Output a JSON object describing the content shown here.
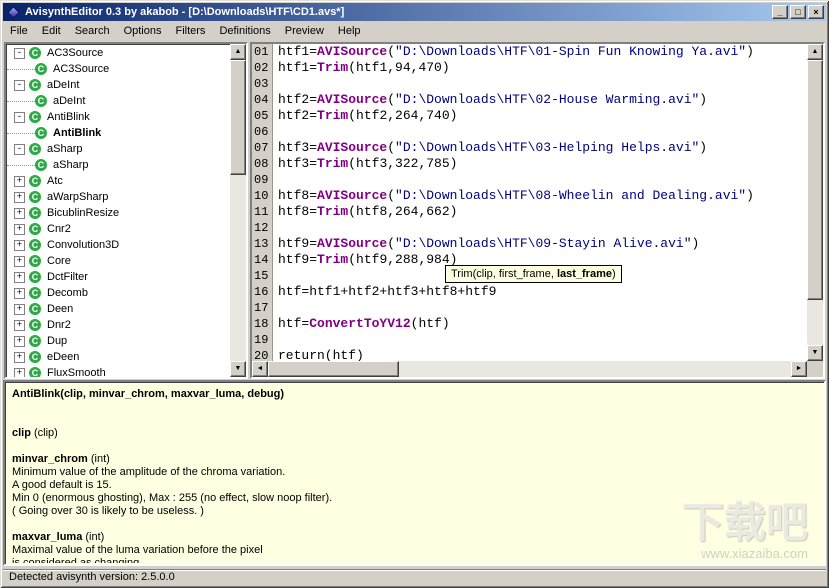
{
  "window": {
    "title": "AvisynthEditor 0.3 by akabob - [D:\\Downloads\\HTF\\CD1.avs*]",
    "buttons": {
      "minimize": "_",
      "maximize": "□",
      "close": "×"
    }
  },
  "menu": {
    "items": [
      "File",
      "Edit",
      "Search",
      "Options",
      "Filters",
      "Definitions",
      "Preview",
      "Help"
    ]
  },
  "icons": {
    "up": "▲",
    "down": "▼",
    "left": "◄",
    "right": "►",
    "expand": "+",
    "collapse": "-"
  },
  "colors": {
    "keyword": "#800080",
    "string": "#000080",
    "titlebar_left": "#0A246A",
    "titlebar_right": "#A6CAF0",
    "help_bg": "#FFFFE1",
    "window_bg": "#D4D0C8"
  },
  "tree": {
    "icon": "C",
    "items": [
      {
        "label": "AC3Source",
        "expanded": true,
        "children": [
          {
            "label": "AC3Source",
            "selected": false
          }
        ]
      },
      {
        "label": "aDeInt",
        "expanded": true,
        "children": [
          {
            "label": "aDeInt",
            "selected": false
          }
        ]
      },
      {
        "label": "AntiBlink",
        "expanded": true,
        "children": [
          {
            "label": "AntiBlink",
            "selected": true
          }
        ]
      },
      {
        "label": "aSharp",
        "expanded": true,
        "children": [
          {
            "label": "aSharp",
            "selected": false
          }
        ]
      },
      {
        "label": "Atc",
        "expanded": false,
        "children": []
      },
      {
        "label": "aWarpSharp",
        "expanded": false,
        "children": []
      },
      {
        "label": "BicublinResize",
        "expanded": false,
        "children": []
      },
      {
        "label": "Cnr2",
        "expanded": false,
        "children": []
      },
      {
        "label": "Convolution3D",
        "expanded": false,
        "children": []
      },
      {
        "label": "Core",
        "expanded": false,
        "children": []
      },
      {
        "label": "DctFilter",
        "expanded": false,
        "children": []
      },
      {
        "label": "Decomb",
        "expanded": false,
        "children": []
      },
      {
        "label": "Deen",
        "expanded": false,
        "children": []
      },
      {
        "label": "Dnr2",
        "expanded": false,
        "children": []
      },
      {
        "label": "Dup",
        "expanded": false,
        "children": []
      },
      {
        "label": "eDeen",
        "expanded": false,
        "children": []
      },
      {
        "label": "FluxSmooth",
        "expanded": false,
        "children": []
      }
    ]
  },
  "editor": {
    "lines": [
      {
        "num": "01",
        "segments": [
          [
            "p",
            "htf1="
          ],
          [
            "k",
            "AVISource"
          ],
          [
            "p",
            "("
          ],
          [
            "s",
            "\"D:\\Downloads\\HTF\\01-Spin Fun Knowing Ya.avi\""
          ],
          [
            "p",
            ")"
          ]
        ]
      },
      {
        "num": "02",
        "segments": [
          [
            "p",
            "htf1="
          ],
          [
            "k",
            "Trim"
          ],
          [
            "p",
            "(htf1,94,470)"
          ]
        ]
      },
      {
        "num": "03",
        "segments": []
      },
      {
        "num": "04",
        "segments": [
          [
            "p",
            "htf2="
          ],
          [
            "k",
            "AVISource"
          ],
          [
            "p",
            "("
          ],
          [
            "s",
            "\"D:\\Downloads\\HTF\\02-House Warming.avi\""
          ],
          [
            "p",
            ")"
          ]
        ]
      },
      {
        "num": "05",
        "segments": [
          [
            "p",
            "htf2="
          ],
          [
            "k",
            "Trim"
          ],
          [
            "p",
            "(htf2,264,740)"
          ]
        ]
      },
      {
        "num": "06",
        "segments": []
      },
      {
        "num": "07",
        "segments": [
          [
            "p",
            "htf3="
          ],
          [
            "k",
            "AVISource"
          ],
          [
            "p",
            "("
          ],
          [
            "s",
            "\"D:\\Downloads\\HTF\\03-Helping Helps.avi\""
          ],
          [
            "p",
            ")"
          ]
        ]
      },
      {
        "num": "08",
        "segments": [
          [
            "p",
            "htf3="
          ],
          [
            "k",
            "Trim"
          ],
          [
            "p",
            "(htf3,322,785)"
          ]
        ]
      },
      {
        "num": "09",
        "segments": []
      },
      {
        "num": "10",
        "segments": [
          [
            "p",
            "htf8="
          ],
          [
            "k",
            "AVISource"
          ],
          [
            "p",
            "("
          ],
          [
            "s",
            "\"D:\\Downloads\\HTF\\08-Wheelin and Dealing.avi\""
          ],
          [
            "p",
            ")"
          ]
        ]
      },
      {
        "num": "11",
        "segments": [
          [
            "p",
            "htf8="
          ],
          [
            "k",
            "Trim"
          ],
          [
            "p",
            "(htf8,264,662)"
          ]
        ]
      },
      {
        "num": "12",
        "segments": []
      },
      {
        "num": "13",
        "segments": [
          [
            "p",
            "htf9="
          ],
          [
            "k",
            "AVISource"
          ],
          [
            "p",
            "("
          ],
          [
            "s",
            "\"D:\\Downloads\\HTF\\09-Stayin Alive.avi\""
          ],
          [
            "p",
            ")"
          ]
        ]
      },
      {
        "num": "14",
        "segments": [
          [
            "p",
            "htf9="
          ],
          [
            "k",
            "Trim"
          ],
          [
            "p",
            "(htf9,288,984)"
          ]
        ]
      },
      {
        "num": "15",
        "segments": []
      },
      {
        "num": "16",
        "segments": [
          [
            "p",
            "htf=htf1+htf2+htf3+htf8+htf9"
          ]
        ]
      },
      {
        "num": "17",
        "segments": []
      },
      {
        "num": "18",
        "segments": [
          [
            "p",
            "htf="
          ],
          [
            "k",
            "ConvertToYV12"
          ],
          [
            "p",
            "(htf)"
          ]
        ]
      },
      {
        "num": "19",
        "segments": []
      },
      {
        "num": "20",
        "segments": [
          [
            "p",
            "return(htf)"
          ]
        ]
      }
    ]
  },
  "tooltip": {
    "segments": [
      [
        "p",
        "Trim(clip, first_frame, "
      ],
      [
        "b",
        "last_frame"
      ],
      [
        "p",
        ")"
      ]
    ]
  },
  "help": {
    "lines": [
      [
        [
          "b",
          "AntiBlink(clip, minvar_chrom, maxvar_luma, debug)"
        ]
      ],
      [],
      [],
      [
        [
          "b",
          "clip"
        ],
        [
          "p",
          " (clip)"
        ]
      ],
      [],
      [
        [
          "b",
          "minvar_chrom"
        ],
        [
          "p",
          " (int)"
        ]
      ],
      [
        [
          "p",
          "Minimum value of the amplitude of the chroma variation."
        ]
      ],
      [
        [
          "p",
          "A good default is 15."
        ]
      ],
      [
        [
          "p",
          "Min 0 (enormous ghosting), Max : 255 (no effect, slow noop filter)."
        ]
      ],
      [
        [
          "p",
          "( Going over 30 is likely to be useless. )"
        ]
      ],
      [],
      [
        [
          "b",
          "maxvar_luma"
        ],
        [
          "p",
          " (int)"
        ]
      ],
      [
        [
          "p",
          "Maximal value of the luma variation before the pixel"
        ]
      ],
      [
        [
          "p",
          "is considered as changing"
        ]
      ]
    ]
  },
  "statusbar": {
    "text": "Detected avisynth version: 2.5.0.0"
  },
  "watermark": {
    "title": "下载吧",
    "url": "www.xiazaiba.com"
  }
}
